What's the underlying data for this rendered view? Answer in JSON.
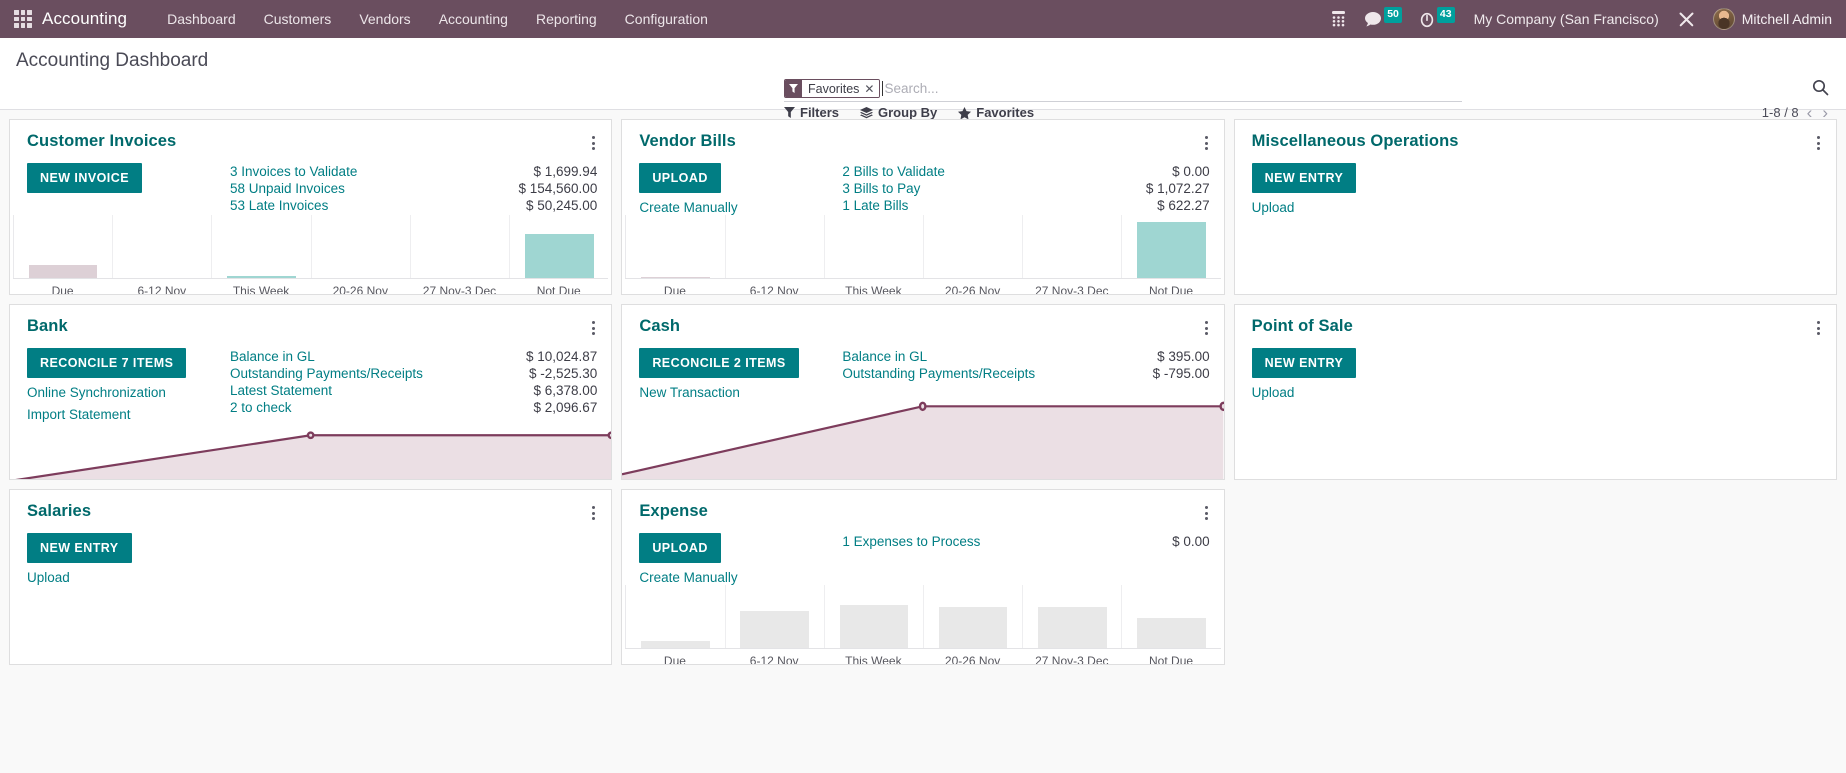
{
  "navbar": {
    "apps_icon": "apps-grid-icon",
    "brand": "Accounting",
    "menu": [
      {
        "label": "Dashboard"
      },
      {
        "label": "Customers"
      },
      {
        "label": "Vendors"
      },
      {
        "label": "Accounting"
      },
      {
        "label": "Reporting"
      },
      {
        "label": "Configuration"
      }
    ],
    "systray": {
      "dialpad_icon": "dialpad-icon",
      "messages_icon": "chat-bubble-icon",
      "messages_count": "50",
      "activities_icon": "clock-icon",
      "activities_count": "43",
      "company": "My Company (San Francisco)",
      "debug_icon": "tools-wrench-icon",
      "avatar_icon": "user-avatar",
      "user_name": "Mitchell Admin"
    }
  },
  "control_panel": {
    "title": "Accounting Dashboard",
    "search": {
      "facet_icon": "filter-funnel-icon",
      "facet_label": "Favorites",
      "facet_remove_icon": "close-icon",
      "placeholder": "Search...",
      "value": "",
      "search_icon": "search-icon"
    },
    "buttons": [
      {
        "label": "Filters",
        "icon": "filter-funnel-icon"
      },
      {
        "label": "Group By",
        "icon": "layers-icon"
      },
      {
        "label": "Favorites",
        "icon": "star-icon"
      }
    ],
    "pager": {
      "count": "1-8 / 8",
      "prev_icon": "chevron-left-icon",
      "next_icon": "chevron-right-icon"
    }
  },
  "theme": {
    "navbar_bg": "#6a4e5f",
    "accent_teal": "#017e84",
    "title_teal": "#00696b",
    "badge_teal": "#00a09d",
    "bar_teal": "#9fd6d2",
    "bar_pink": "#ddd0d6",
    "bar_grey": "#e8e8e8",
    "line_purple": "#7d3c5c",
    "area_fill": "#ebdfe4"
  },
  "cards": [
    {
      "title": "Customer Invoices",
      "kebab_icon": "kebab-menu-icon",
      "primary_button": "NEW INVOICE",
      "links": [],
      "stats": [
        {
          "label": "3 Invoices to Validate",
          "value": "$ 1,699.94"
        },
        {
          "label": "58 Unpaid Invoices",
          "value": "$ 154,560.00"
        },
        {
          "label": "53 Late Invoices",
          "value": "$ 50,245.00"
        }
      ],
      "graph": {
        "type": "bar",
        "categories": [
          "Due",
          "6-12 Nov",
          "This Week",
          "20-26 Nov",
          "27 Nov-3 Dec",
          "Not Due"
        ],
        "values": [
          14,
          0,
          2,
          0,
          0,
          45
        ],
        "colors": [
          "#ddd0d6",
          "#9fd6d2",
          "#9fd6d2",
          "#9fd6d2",
          "#9fd6d2",
          "#9fd6d2"
        ],
        "ylim": [
          0,
          64
        ]
      }
    },
    {
      "title": "Vendor Bills",
      "kebab_icon": "kebab-menu-icon",
      "primary_button": "UPLOAD",
      "links": [
        "Create Manually"
      ],
      "stats": [
        {
          "label": "2 Bills to Validate",
          "value": "$ 0.00"
        },
        {
          "label": "3 Bills to Pay",
          "value": "$ 1,072.27"
        },
        {
          "label": "1 Late Bills",
          "value": "$ 622.27"
        }
      ],
      "graph": {
        "type": "bar",
        "categories": [
          "Due",
          "6-12 Nov",
          "This Week",
          "20-26 Nov",
          "27 Nov-3 Dec",
          "Not Due"
        ],
        "values": [
          1.5,
          0,
          0,
          0,
          0,
          57
        ],
        "colors": [
          "#ddd0d6",
          "#9fd6d2",
          "#9fd6d2",
          "#9fd6d2",
          "#9fd6d2",
          "#9fd6d2"
        ],
        "ylim": [
          0,
          64
        ]
      }
    },
    {
      "title": "Miscellaneous Operations",
      "kebab_icon": "kebab-menu-icon",
      "primary_button": "NEW ENTRY",
      "links": [
        "Upload"
      ],
      "stats": [],
      "graph": null
    },
    {
      "title": "Bank",
      "kebab_icon": "kebab-menu-icon",
      "primary_button": "RECONCILE 7 ITEMS",
      "links": [
        "Online Synchronization",
        "Import Statement"
      ],
      "stats": [
        {
          "label": "Balance in GL",
          "value": "$ 10,024.87"
        },
        {
          "label": "Outstanding Payments/Receipts",
          "value": "$ -2,525.30"
        },
        {
          "label": "Latest Statement",
          "value": "$ 6,378.00"
        },
        {
          "label": "2 to check",
          "value": "$ 2,096.67"
        }
      ],
      "graph": {
        "type": "area",
        "x": [
          0,
          0.5,
          1
        ],
        "values": [
          2,
          78,
          78
        ],
        "markers": [
          false,
          true,
          true
        ],
        "ylim": [
          0,
          100
        ]
      }
    },
    {
      "title": "Cash",
      "kebab_icon": "kebab-menu-icon",
      "primary_button": "RECONCILE 2 ITEMS",
      "links": [
        "New Transaction"
      ],
      "stats": [
        {
          "label": "Balance in GL",
          "value": "$ 395.00"
        },
        {
          "label": "Outstanding Payments/Receipts",
          "value": "$ -795.00"
        }
      ],
      "graph": {
        "type": "area",
        "x": [
          0,
          0.5,
          1
        ],
        "values": [
          6,
          92,
          92
        ],
        "markers": [
          false,
          true,
          true
        ],
        "ylim": [
          0,
          100
        ]
      }
    },
    {
      "title": "Point of Sale",
      "kebab_icon": "kebab-menu-icon",
      "primary_button": "NEW ENTRY",
      "links": [
        "Upload"
      ],
      "stats": [],
      "graph": null
    },
    {
      "title": "Salaries",
      "kebab_icon": "kebab-menu-icon",
      "primary_button": "NEW ENTRY",
      "links": [
        "Upload"
      ],
      "stats": [],
      "graph": null
    },
    {
      "title": "Expense",
      "kebab_icon": "kebab-menu-icon",
      "primary_button": "UPLOAD",
      "links": [
        "Create Manually"
      ],
      "stats": [
        {
          "label": "1 Expenses to Process",
          "value": "$ 0.00"
        }
      ],
      "graph": {
        "type": "bar",
        "categories": [
          "Due",
          "6-12 Nov",
          "This Week",
          "20-26 Nov",
          "27 Nov-3 Dec",
          "Not Due"
        ],
        "values": [
          7,
          38,
          44,
          42,
          42,
          30
        ],
        "colors": [
          "#e8e8e8",
          "#e8e8e8",
          "#e8e8e8",
          "#e8e8e8",
          "#e8e8e8",
          "#e8e8e8"
        ],
        "ylim": [
          0,
          64
        ]
      }
    }
  ]
}
